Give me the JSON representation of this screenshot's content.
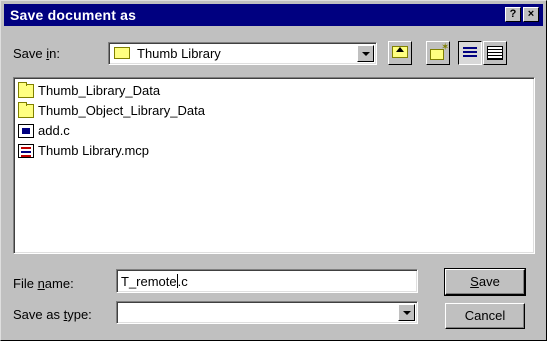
{
  "dialog": {
    "title": "Save document as",
    "help_btn": "?",
    "close_btn": "×"
  },
  "save_in": {
    "label_prefix": "Save ",
    "label_access": "i",
    "label_suffix": "n:",
    "value": "Thumb Library"
  },
  "toolbar": {
    "up_folder": "up-one-level-icon",
    "new_folder": "create-new-folder-icon",
    "list_view": "list-view-icon",
    "details_view": "details-view-icon"
  },
  "files": [
    {
      "name": "Thumb_Library_Data",
      "icon": "folder-icon"
    },
    {
      "name": "Thumb_Object_Library_Data",
      "icon": "folder-icon"
    },
    {
      "name": "add.c",
      "icon": "c-source-file-icon"
    },
    {
      "name": "Thumb Library.mcp",
      "icon": "project-file-icon"
    }
  ],
  "file_name": {
    "label_prefix": "File ",
    "label_access": "n",
    "label_suffix": "ame:",
    "value_before_caret": "T_remote",
    "value_after_caret": ".c"
  },
  "save_as_type": {
    "label_prefix": "Save as ",
    "label_access": "t",
    "label_suffix": "ype:",
    "value": ""
  },
  "buttons": {
    "save_access": "S",
    "save_rest": "ave",
    "cancel": "Cancel"
  }
}
